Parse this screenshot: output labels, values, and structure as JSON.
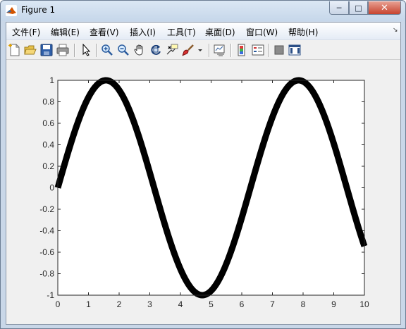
{
  "window": {
    "title": "Figure 1",
    "controls": {
      "minimize_icon": "minimize-icon",
      "maximize_icon": "maximize-icon",
      "close_icon": "close-icon"
    }
  },
  "menu": {
    "items": [
      "文件(F)",
      "编辑(E)",
      "查看(V)",
      "插入(I)",
      "工具(T)",
      "桌面(D)",
      "窗口(W)",
      "帮助(H)"
    ]
  },
  "toolbar": {
    "icons": [
      "new-figure-icon",
      "open-file-icon",
      "save-icon",
      "print-icon",
      "edit-plot-arrow-icon",
      "zoom-in-icon",
      "zoom-out-icon",
      "pan-hand-icon",
      "rotate-3d-icon",
      "data-cursor-icon",
      "brush-icon",
      "brush-dropdown-icon",
      "link-plot-icon",
      "colorbar-icon",
      "legend-icon",
      "hide-plot-tools-icon",
      "show-plot-tools-icon"
    ]
  },
  "chart_data": {
    "type": "line",
    "function": "sin(x)",
    "x": [
      0,
      0.5,
      1,
      1.5,
      2,
      2.5,
      3,
      3.5,
      4,
      4.5,
      5,
      5.5,
      6,
      6.5,
      7,
      7.5,
      8,
      8.5,
      9,
      9.5,
      10
    ],
    "series": [
      {
        "values": [
          0,
          0.479,
          0.841,
          0.997,
          0.909,
          0.598,
          0.141,
          -0.351,
          -0.757,
          -0.978,
          -0.959,
          -0.706,
          -0.279,
          0.215,
          0.657,
          0.938,
          0.989,
          0.798,
          0.412,
          -0.075,
          -0.544
        ],
        "color": "#000000",
        "line_style": "thick solid"
      }
    ],
    "xlim": [
      0,
      10
    ],
    "ylim": [
      -1,
      1
    ],
    "xticks": [
      "0",
      "1",
      "2",
      "3",
      "4",
      "5",
      "6",
      "7",
      "8",
      "9",
      "10"
    ],
    "yticks": [
      "-1",
      "-0.8",
      "-0.6",
      "-0.4",
      "-0.2",
      "0",
      "0.2",
      "0.4",
      "0.6",
      "0.8",
      "1"
    ],
    "title": "",
    "xlabel": "",
    "ylabel": "",
    "grid": false
  }
}
